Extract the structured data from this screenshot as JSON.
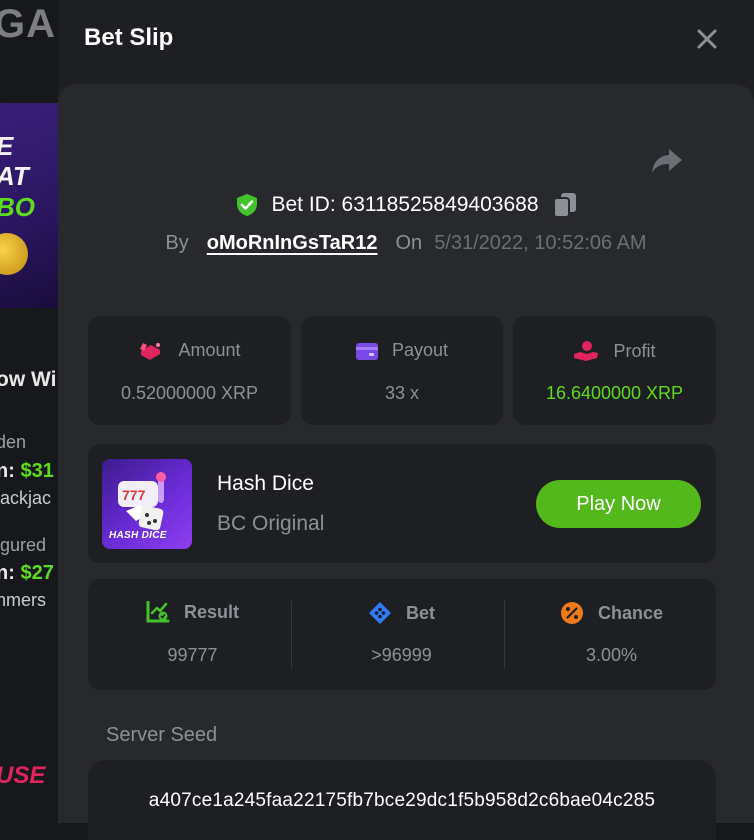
{
  "background": {
    "logo_fragment": "GAI",
    "banner_line1": "E",
    "banner_line2": "AT",
    "banner_line2_green": "BO",
    "text1": "ow Wi",
    "text2": "den",
    "text3_prefix": "n:",
    "text3_amount": "$31",
    "text4": "lackjac",
    "text5": "igured",
    "text6_prefix": "n:",
    "text6_amount": "$27",
    "text7": "nmers",
    "promo": "USE"
  },
  "dialog": {
    "title": "Bet Slip"
  },
  "bet": {
    "id_label": "Bet ID: 63118525849403688",
    "by_label": "By",
    "user": "oMoRnInGsTaR12",
    "on_label": "On",
    "date": "5/31/2022, 10:52:06 AM"
  },
  "stats": {
    "amount": {
      "label": "Amount",
      "value": "0.52000000 XRP"
    },
    "payout": {
      "label": "Payout",
      "value": "33 x"
    },
    "profit": {
      "label": "Profit",
      "value": "16.6400000 XRP"
    }
  },
  "game": {
    "name": "Hash Dice",
    "subtitle": "BC Original",
    "thumb_label": "HASH DICE",
    "play_label": "Play Now"
  },
  "results": {
    "result": {
      "label": "Result",
      "value": "99777"
    },
    "bet": {
      "label": "Bet",
      "value": ">96999"
    },
    "chance": {
      "label": "Chance",
      "value": "3.00%"
    }
  },
  "seed": {
    "label": "Server Seed",
    "value": "a407ce1a245faa22175fb7bce29dc1f5b958d2c6bae04c285"
  },
  "colors": {
    "accent_green": "#53b81b",
    "profit_green": "#5ddc1d",
    "payout_purple": "#7b4ae6",
    "bet_blue": "#2f7df6",
    "chance_orange": "#ef7a1a",
    "amount_pink": "#e0245e"
  },
  "icons": {
    "close": "close-icon",
    "share": "share-icon",
    "verified": "shield-check-icon",
    "copy": "copy-icon",
    "amount": "chips-icon",
    "payout": "wallet-icon",
    "profit": "hand-coin-icon",
    "result": "chart-check-icon",
    "bet": "diamond-dice-icon",
    "chance": "percent-icon"
  }
}
